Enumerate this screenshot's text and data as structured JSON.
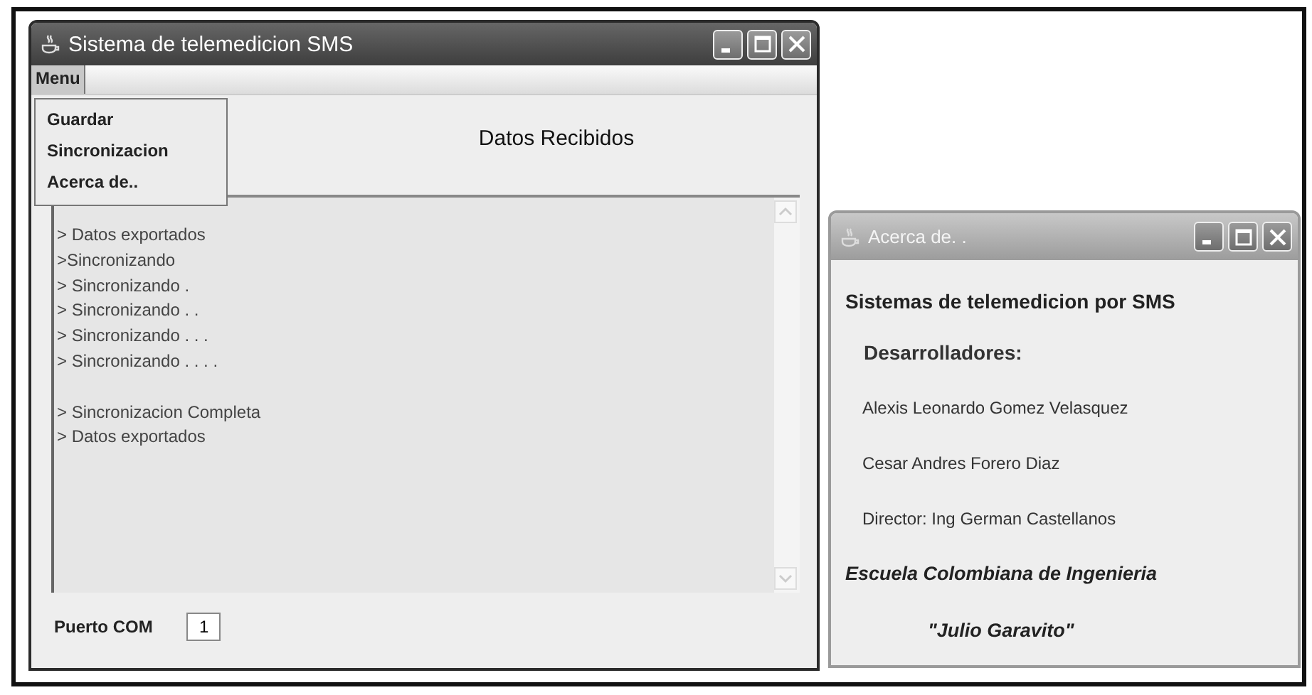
{
  "main_window": {
    "title": "Sistema de telemedicion SMS",
    "menu_bar": [
      {
        "label": "Menu",
        "expanded": true
      }
    ],
    "menu_items": [
      "Guardar",
      "Sincronizacion",
      "Acerca de.."
    ],
    "heading": "Datos Recibidos",
    "log_blocks": [
      {
        "lines": [
          "> Datos exportados",
          ">Sincronizando",
          "> Sincronizando .",
          "> Sincronizando . .",
          "> Sincronizando . . .",
          "> Sincronizando . . . ."
        ]
      },
      {
        "lines": [
          "> Sincronizacion Completa",
          "> Datos exportados"
        ]
      }
    ],
    "port": {
      "label": "Puerto COM",
      "value": "1"
    }
  },
  "about_window": {
    "title": "Acerca de. .",
    "lines": [
      {
        "kind": "title",
        "text": "Sistemas de telemedicion por SMS"
      },
      {
        "kind": "heading",
        "text": "Desarrolladores:"
      },
      {
        "kind": "body",
        "text": "Alexis Leonardo Gomez Velasquez"
      },
      {
        "kind": "body",
        "text": "Cesar Andres Forero Diaz"
      },
      {
        "kind": "body",
        "text": "Director: Ing German Castellanos"
      },
      {
        "kind": "emphasis",
        "text": "Escuela Colombiana de Ingenieria"
      },
      {
        "kind": "subtitle",
        "text": "\"Julio Garavito\""
      }
    ]
  }
}
